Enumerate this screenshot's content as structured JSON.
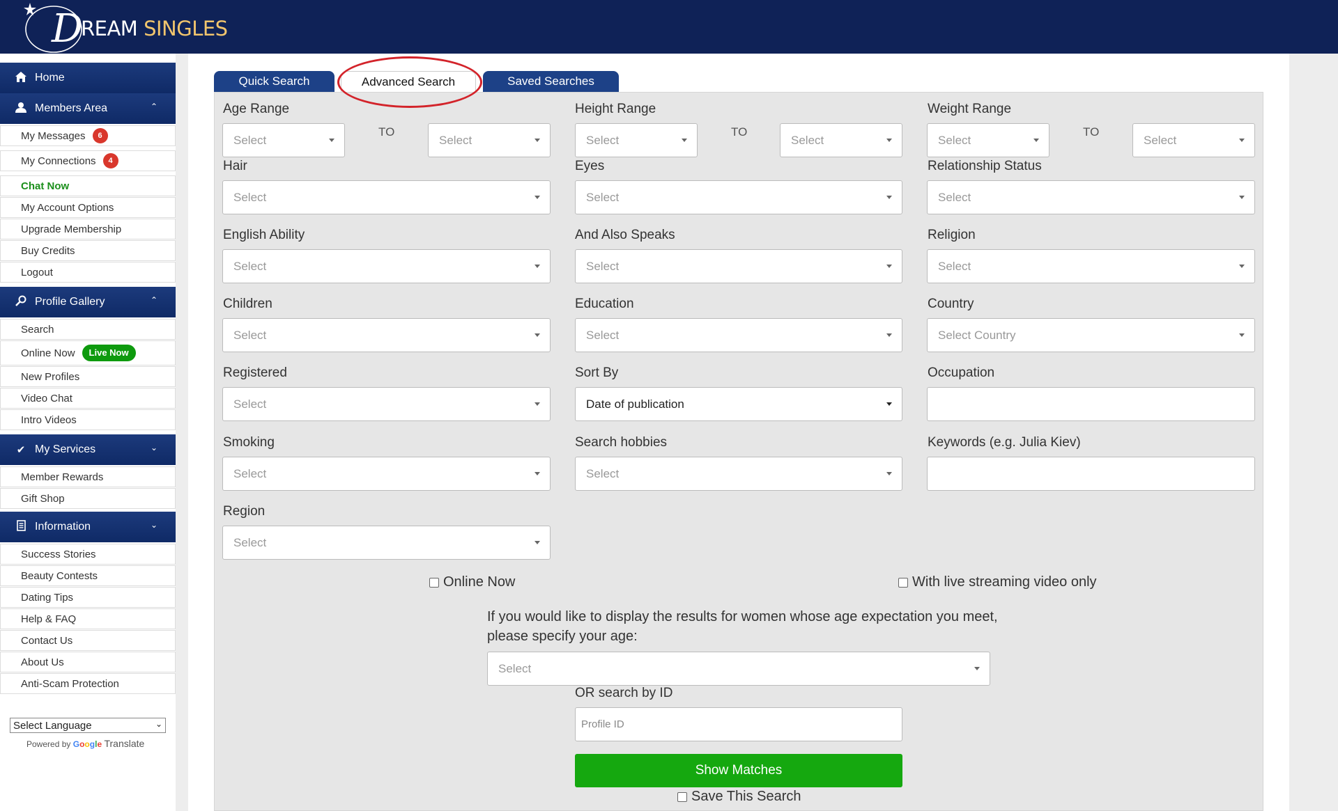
{
  "header": {
    "logo_text_a": "REAM",
    "logo_text_b": "SINGLES",
    "logo_letter": "D"
  },
  "sidebar": {
    "home": "Home",
    "members_area": "Members Area",
    "members_items": [
      {
        "label": "My Messages",
        "badge": "6"
      },
      {
        "label": "My Connections",
        "badge": "4"
      },
      {
        "label": "Chat Now"
      },
      {
        "label": "My Account Options"
      },
      {
        "label": "Upgrade Membership"
      },
      {
        "label": "Buy Credits"
      },
      {
        "label": "Logout"
      }
    ],
    "profile_gallery": "Profile Gallery",
    "gallery_items": [
      {
        "label": "Search"
      },
      {
        "label": "Online Now",
        "badge": "Live Now"
      },
      {
        "label": "New Profiles"
      },
      {
        "label": "Video Chat"
      },
      {
        "label": "Intro Videos"
      }
    ],
    "my_services": "My Services",
    "services_items": [
      {
        "label": "Member Rewards"
      },
      {
        "label": "Gift Shop"
      }
    ],
    "information": "Information",
    "info_items": [
      {
        "label": "Success Stories"
      },
      {
        "label": "Beauty Contests"
      },
      {
        "label": "Dating Tips"
      },
      {
        "label": "Help & FAQ"
      },
      {
        "label": "Contact Us"
      },
      {
        "label": "About Us"
      },
      {
        "label": "Anti-Scam Protection"
      }
    ],
    "language_select": "Select Language",
    "powered_by": "Powered by",
    "translate": "Translate"
  },
  "tabs": {
    "quick": "Quick Search",
    "advanced": "Advanced Search",
    "saved": "Saved Searches"
  },
  "form": {
    "age_range": "Age Range",
    "height_range": "Height Range",
    "weight_range": "Weight Range",
    "to": "TO",
    "hair": "Hair",
    "eyes": "Eyes",
    "relationship_status": "Relationship Status",
    "english_ability": "English Ability",
    "also_speaks": "And Also Speaks",
    "religion": "Religion",
    "children": "Children",
    "education": "Education",
    "country": "Country",
    "registered": "Registered",
    "sort_by": "Sort By",
    "occupation": "Occupation",
    "smoking": "Smoking",
    "search_hobbies": "Search hobbies",
    "keywords": "Keywords (e.g. Julia Kiev)",
    "region": "Region",
    "select": "Select",
    "select_country": "Select Country",
    "sort_value": "Date of publication",
    "online_now": "Online Now",
    "live_streaming": "With live streaming video only",
    "age_note": "If you would like to display the results for women whose age expectation you meet, please specify your age:",
    "search_by_id": "OR search by ID",
    "profile_id_placeholder": "Profile ID",
    "show_matches": "Show Matches",
    "save_search": "Save This Search"
  }
}
